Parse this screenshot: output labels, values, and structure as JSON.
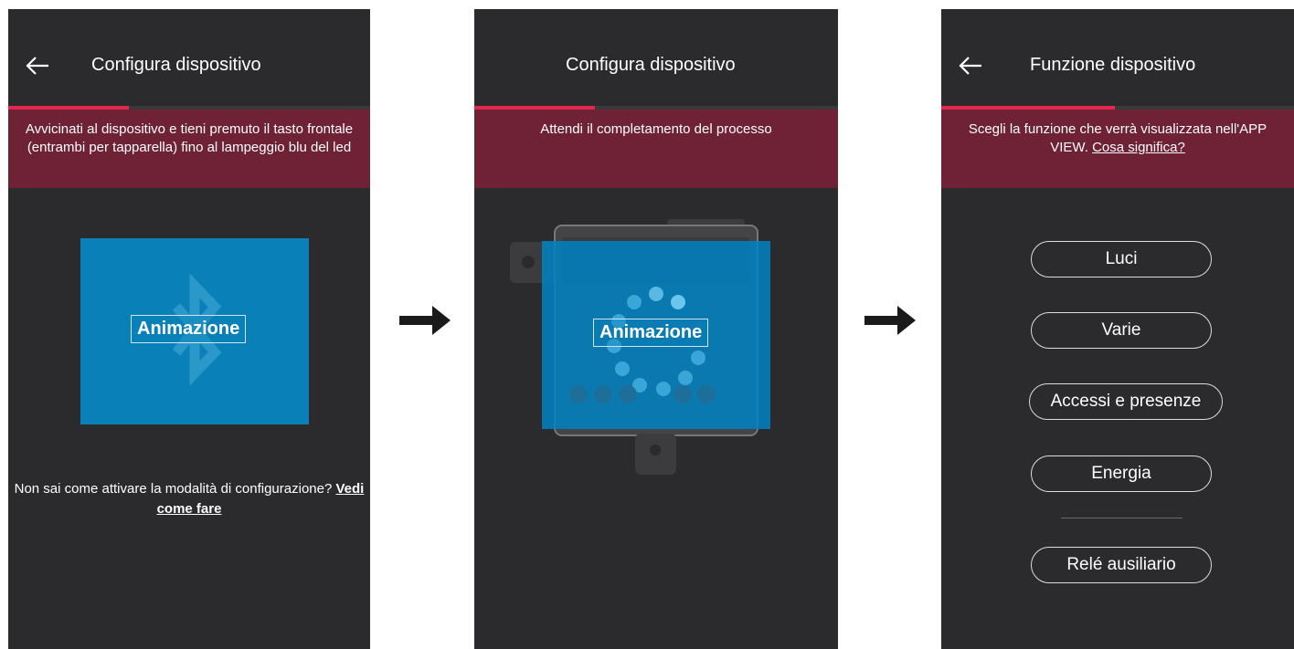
{
  "screen1": {
    "title": "Configura dispositivo",
    "banner": "Avvicinati al dispositivo e tieni premuto il tasto frontale (entrambi per tapparella) fino al lampeggio blu del led",
    "animation_label": "Animazione",
    "help_text": "Non sai come attivare la modalità di configurazione?",
    "help_link": "Vedi come fare",
    "progress_percent": 33
  },
  "screen2": {
    "title": "Configura dispositivo",
    "banner": "Attendi il completamento del processo",
    "animation_label": "Animazione",
    "progress_percent": 33
  },
  "screen3": {
    "title": "Funzione dispositivo",
    "banner_text": "Scegli la funzione che verrà visualizzata nell'APP VIEW.",
    "banner_link": "Cosa significa?",
    "progress_percent": 50,
    "options": [
      "Luci",
      "Varie",
      "Accessi e presenze",
      "Energia"
    ],
    "extra_option": "Relé ausiliario"
  },
  "colors": {
    "screen_bg": "#2b2a2c",
    "banner": "#6f2136",
    "progress": "#e2264d",
    "animation_blue": "#0a80b8"
  },
  "icons": [
    "back-arrow-icon",
    "bluetooth-icon",
    "right-arrow-icon",
    "loading-spinner-icon"
  ]
}
